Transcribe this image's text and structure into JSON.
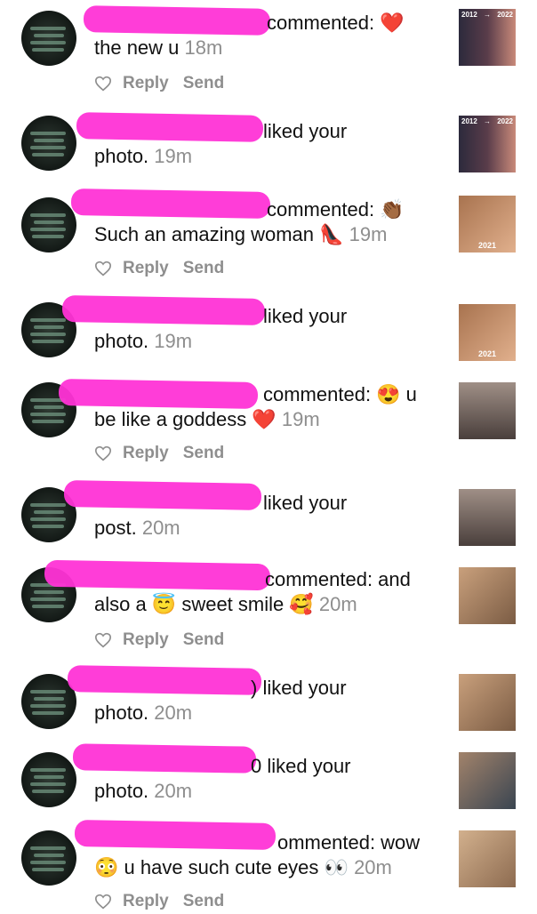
{
  "notifications": [
    {
      "line1": "commented: ❤️",
      "line2_text": "the new u",
      "time": "18m",
      "line2b": "",
      "actions": true,
      "thumb": "ba"
    },
    {
      "line1": "liked your",
      "line2_text": "photo.",
      "time": "19m",
      "line2b": "",
      "actions": false,
      "thumb": "ba"
    },
    {
      "line1": "commented: 👏🏾",
      "line2_text": "Such an amazing woman 👠",
      "time": "19m",
      "line2b": "",
      "actions": true,
      "thumb": "2021"
    },
    {
      "line1": "liked your",
      "line2_text": "photo.",
      "time": "19m",
      "line2b": "",
      "actions": false,
      "thumb": "2021"
    },
    {
      "line1": "commented: 😍 u",
      "line2_text": "be like a goddess ❤️",
      "time": "19m",
      "line2b": "",
      "actions": true,
      "thumb": "flex"
    },
    {
      "line1": "liked your",
      "line2_text": "post.",
      "time": "20m",
      "line2b": "",
      "actions": false,
      "thumb": "flex"
    },
    {
      "line1": "commented: and",
      "line2_text": "also a 😇 sweet smile 🥰",
      "time": "20m",
      "line2b": "",
      "actions": true,
      "thumb": "smile"
    },
    {
      "line1": ") liked your",
      "line2_text": "photo.",
      "time": "20m",
      "line2b": "",
      "actions": false,
      "thumb": "smile"
    },
    {
      "line1": "0 liked your",
      "line2_text": "photo.",
      "time": "20m",
      "line2b": "",
      "actions": false,
      "thumb": "tank"
    },
    {
      "line1": "ommented: wow",
      "line2_text": "😳 u have such cute eyes 👀",
      "time": "20m",
      "line2b": "",
      "actions": true,
      "thumb": "eyes"
    }
  ],
  "labels": {
    "reply": "Reply",
    "send": "Send"
  },
  "thumb_text": {
    "year_from": "2012",
    "arrow": "→",
    "year_to": "2022",
    "year_2021": "2021"
  },
  "colors": {
    "redaction": "#ff33d6",
    "muted": "#8e8e8e"
  }
}
